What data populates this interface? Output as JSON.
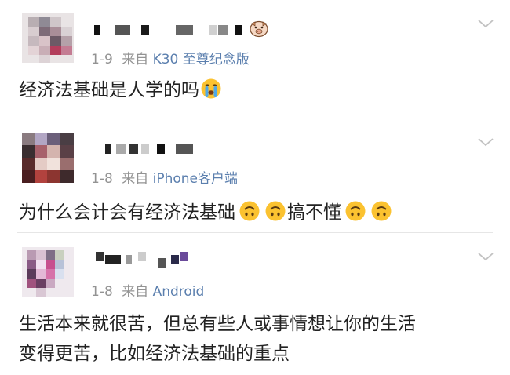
{
  "comments": [
    {
      "meta_date": "1-9",
      "meta_from": "来自",
      "meta_source": "K30 至尊纪念版",
      "content_before_emoji": "经济法基础是人学的吗",
      "emoji": "crying-face-emoji",
      "badge_icon": "piggy-icon"
    },
    {
      "meta_date": "1-8",
      "meta_from": "来自",
      "meta_source": "iPhone客户端",
      "content_part1": "为什么会计会有经济法基础",
      "content_part2": "搞不懂",
      "emoji": "upside-down-face-emoji"
    },
    {
      "meta_date": "1-8",
      "meta_from": "来自",
      "meta_source": "Android",
      "content_line1": "生活本来就很苦，但总有些人或事情想让你的生活",
      "content_line2": "变得更苦，比如经济法基础的重点"
    }
  ],
  "colors": {
    "meta_text": "#939393",
    "source_link": "#5b7fae",
    "content_text": "#222222",
    "emoji_yellow": "#fbc230"
  }
}
